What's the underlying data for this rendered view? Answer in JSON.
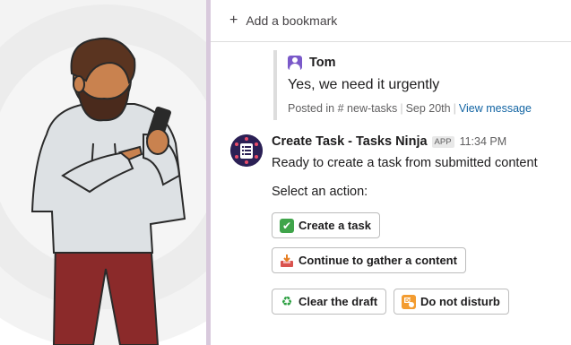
{
  "bookmark_bar": {
    "plus_icon": "+",
    "label": "Add a bookmark"
  },
  "quoted_message": {
    "author": "Tom",
    "text": "Yes, we need it urgently",
    "meta": {
      "posted_in": "Posted in",
      "channel": "# new-tasks",
      "date": "Sep 20th",
      "link": "View message"
    }
  },
  "message": {
    "sender": "Create Task - Tasks Ninja",
    "badge": "APP",
    "time": "11:34 PM",
    "text": "Ready to create a task from submitted content",
    "select_label": "Select an action:"
  },
  "actions": [
    {
      "label": "Create a task",
      "icon": "check-mark-icon",
      "glyph": "✔"
    },
    {
      "label": "Continue to gather a content",
      "icon": "inbox-tray-icon",
      "glyph": "📥"
    },
    {
      "label": "Clear the draft",
      "icon": "recycle-icon",
      "glyph": "♻"
    },
    {
      "label": "Do not disturb",
      "icon": "do-not-disturb-icon",
      "glyph": "⛔"
    }
  ],
  "colors": {
    "link": "#1264a3",
    "sidebar_divider": "#d8c9dc",
    "app_avatar": "#2b2055",
    "user_avatar": "#7a59c9"
  }
}
